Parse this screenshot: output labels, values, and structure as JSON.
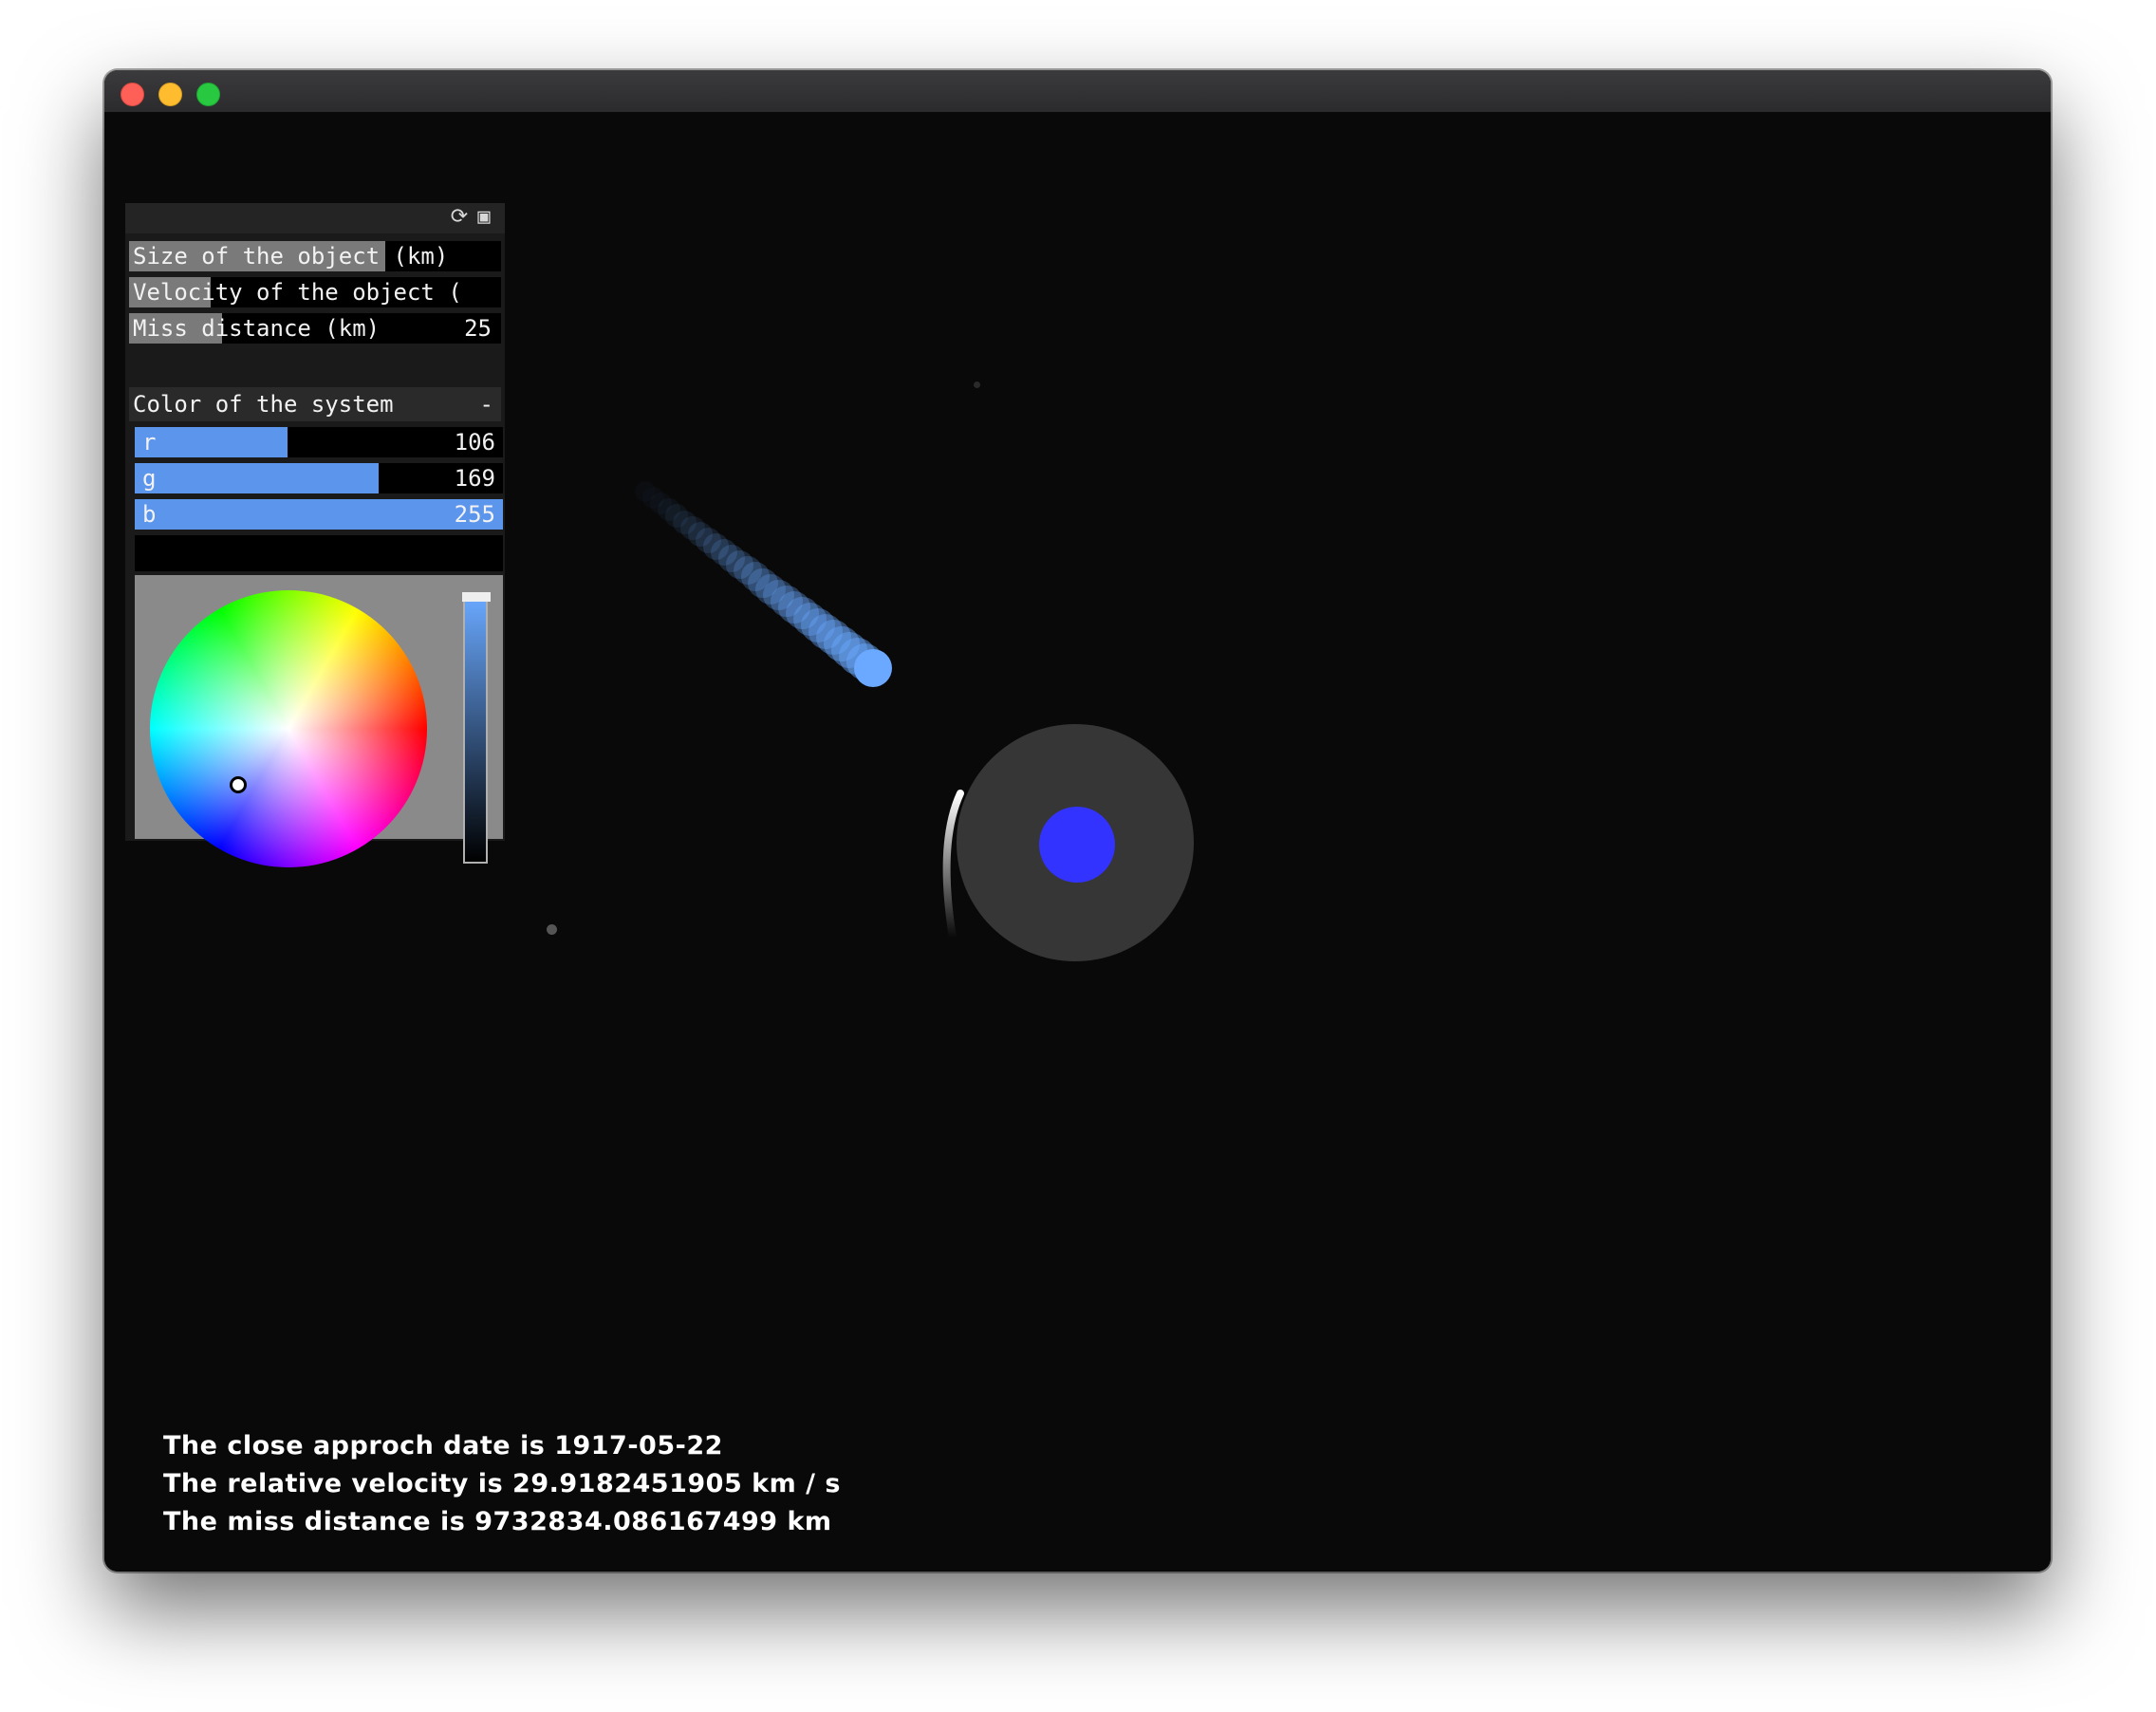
{
  "window": {
    "traffic_lights": {
      "close": "#fe5f57",
      "minimize": "#febc2e",
      "maximize": "#28c840"
    }
  },
  "gui": {
    "header_icons": [
      "reload-icon",
      "save-icon"
    ],
    "sliders": [
      {
        "label": "Size of the object (km)",
        "value": "",
        "fill": 0.69
      },
      {
        "label": "Velocity of the object (",
        "value": "",
        "fill": 0.22
      },
      {
        "label": "Miss distance (km)",
        "value": "25",
        "fill": 0.25
      }
    ],
    "color_group": {
      "label": "Color of the system",
      "collapse": "-",
      "channels": [
        {
          "label": "r",
          "value": "106",
          "fill": 0.416
        },
        {
          "label": "g",
          "value": "169",
          "fill": 0.663
        },
        {
          "label": "b",
          "value": "255",
          "fill": 1.0
        }
      ],
      "color": "#6aa9ff"
    }
  },
  "scene": {
    "object_color": "#6aa9ff",
    "planet_color": "#3333ff",
    "halo_color": "#363636"
  },
  "info": {
    "date_line": "The close approch date is 1917-05-22",
    "velocity_line": "The relative velocity is 29.9182451905 km / s",
    "distance_line": "The miss distance is 9732834.086167499 km"
  }
}
